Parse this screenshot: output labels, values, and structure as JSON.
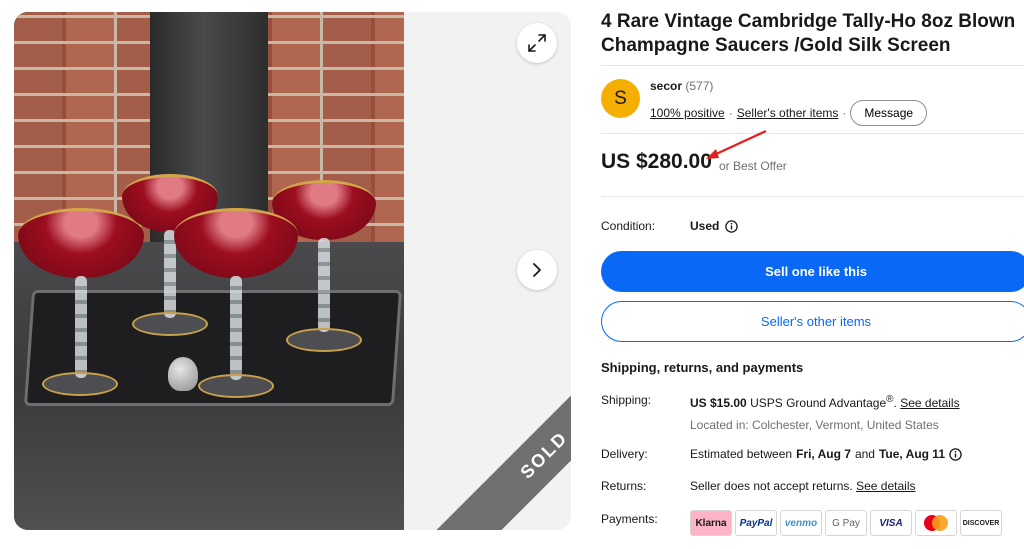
{
  "listing": {
    "title": "4 Rare Vintage Cambridge Tally-Ho 8oz Blown Champagne Saucers /Gold Silk Screen",
    "sold_label": "SOLD"
  },
  "seller": {
    "avatar_letter": "S",
    "name": "secor",
    "feedback_count": "(577)",
    "positive": "100% positive",
    "other_items_link": "Seller's other items",
    "message_label": "Message"
  },
  "price": {
    "amount": "US $280.00",
    "best_offer": "or Best Offer"
  },
  "condition": {
    "label": "Condition:",
    "value": "Used"
  },
  "actions": {
    "sell_one": "Sell one like this",
    "other_items": "Seller's other items"
  },
  "shipping": {
    "heading": "Shipping, returns, and payments",
    "shipping_label": "Shipping:",
    "shipping_cost": "US $15.00",
    "shipping_service": "USPS Ground Advantage",
    "shipping_reg": "®",
    "shipping_link": "See details",
    "located_in": "Located in: Colchester, Vermont, United States",
    "delivery_label": "Delivery:",
    "delivery_prefix": "Estimated between",
    "delivery_start": "Fri, Aug 7",
    "delivery_and": "and",
    "delivery_end": "Tue, Aug 11",
    "returns_label": "Returns:",
    "returns_text": "Seller does not accept returns.",
    "returns_link": "See details",
    "payments_label": "Payments:"
  },
  "payment_methods": [
    "Klarna",
    "PayPal",
    "venmo",
    "G Pay",
    "VISA",
    "",
    "DISCOVER"
  ],
  "icons": {
    "expand": "expand-icon",
    "next": "chevron-right-icon",
    "info": "info-icon",
    "annotation": "red-arrow-annotation"
  },
  "colors": {
    "primary_blue": "#0968f6",
    "avatar_yellow": "#f5af02",
    "sold_ribbon": "#707070",
    "annotation_red": "#e0201c"
  }
}
